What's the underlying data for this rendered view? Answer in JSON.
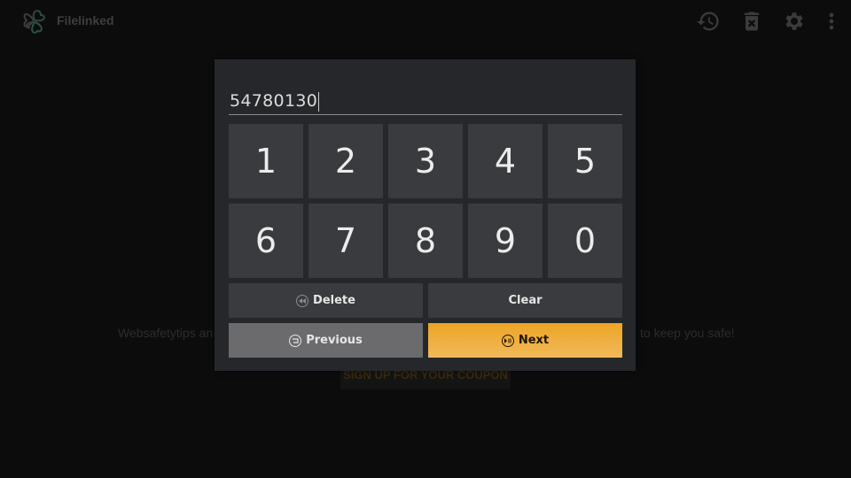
{
  "app": {
    "title": "Filelinked",
    "logo_icon": "clover-logo-icon"
  },
  "toolbar": {
    "icons": [
      "history-icon",
      "delete-icon",
      "gear-icon",
      "more-vert-icon"
    ]
  },
  "background": {
    "text_left": "Websafetytips an",
    "text_right": "to keep you safe!",
    "coupon_button": "SIGN UP FOR YOUR COUPON"
  },
  "dialog": {
    "input_value": "54780130",
    "keys": [
      "1",
      "2",
      "3",
      "4",
      "5",
      "6",
      "7",
      "8",
      "9",
      "0"
    ],
    "delete_label": "Delete",
    "clear_label": "Clear",
    "previous_label": "Previous",
    "next_label": "Next",
    "colors": {
      "accent": "#eda425",
      "panel": "#26272a",
      "key": "#3a3b3e",
      "previous": "#6b6b6d"
    }
  }
}
